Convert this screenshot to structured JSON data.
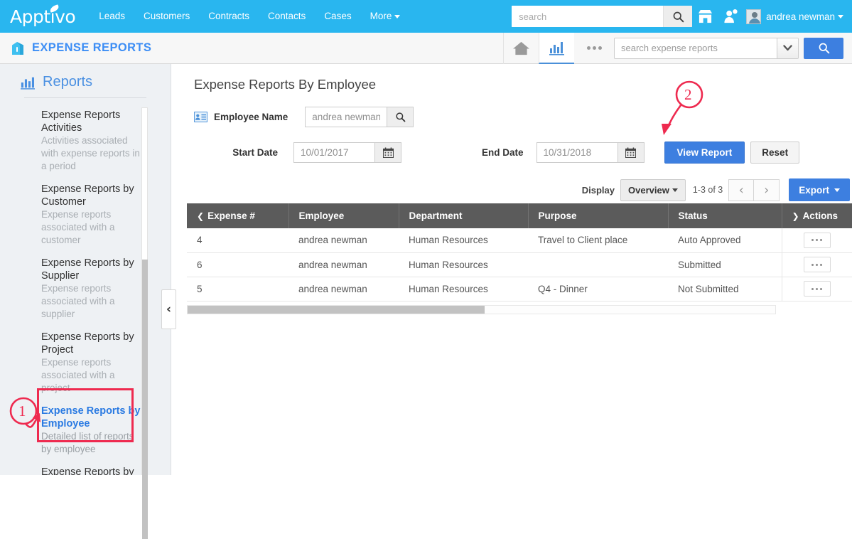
{
  "topnav": {
    "logo": "Apptivo",
    "links": [
      "Leads",
      "Customers",
      "Contracts",
      "Contacts",
      "Cases",
      "More"
    ],
    "search_placeholder": "search",
    "search_value": "",
    "icons": [
      "search-icon",
      "store-icon",
      "notifications-icon"
    ],
    "username": "andrea newman"
  },
  "appbar": {
    "title": "EXPENSE REPORTS",
    "icons": [
      "home-icon",
      "reports-chart-icon",
      "more-ellipsis-icon"
    ],
    "search_placeholder": "search expense reports",
    "search_value": ""
  },
  "sidebar": {
    "heading": "Reports",
    "items": [
      {
        "title": "Expense Reports Activities",
        "desc": "Activities associated with expense reports in a period",
        "active": false
      },
      {
        "title": "Expense Reports by Customer",
        "desc": "Expense reports associated with a customer",
        "active": false
      },
      {
        "title": "Expense Reports by Supplier",
        "desc": "Expense reports associated with a supplier",
        "active": false
      },
      {
        "title": "Expense Reports by Project",
        "desc": "Expense reports associated with a project",
        "active": false
      },
      {
        "title": "Expense Reports by Employee",
        "desc": "Detailed list of reports by employee",
        "active": true
      },
      {
        "title": "Expense Reports by Status",
        "desc": "",
        "active": false
      }
    ],
    "collapse_glyph": "‹"
  },
  "main": {
    "page_title": "Expense Reports By Employee",
    "filters": {
      "employee_label": "Employee Name",
      "employee_value": "andrea newman",
      "start_label": "Start Date",
      "start_value": "10/01/2017",
      "end_label": "End Date",
      "end_value": "10/31/2018",
      "view_report_label": "View Report",
      "reset_label": "Reset"
    },
    "toolbar": {
      "display_label": "Display",
      "display_value": "Overview",
      "page_count": "1-3 of 3",
      "prev_glyph": "‹",
      "next_glyph": "›",
      "export_label": "Export"
    },
    "table": {
      "columns": [
        "Expense #",
        "Employee",
        "Department",
        "Purpose",
        "Status",
        "Actions"
      ],
      "rows": [
        {
          "expense": "4",
          "employee": "andrea newman",
          "department": "Human Resources",
          "purpose": "Travel to Client place",
          "status": "Auto Approved"
        },
        {
          "expense": "6",
          "employee": "andrea newman",
          "department": "Human Resources",
          "purpose": "",
          "status": "Submitted"
        },
        {
          "expense": "5",
          "employee": "andrea newman",
          "department": "Human Resources",
          "purpose": "Q4 - Dinner",
          "status": "Not Submitted"
        }
      ]
    }
  },
  "annotations": [
    {
      "number": "1",
      "target": "sidebar-item-expense-reports-by-employee"
    },
    {
      "number": "2",
      "target": "view-report-button"
    }
  ],
  "colors": {
    "brand_blue": "#29b6ef",
    "action_blue": "#3d7fe0",
    "link_blue": "#2a7ae2",
    "table_header": "#5b5b5b",
    "annotation_red": "#ee2a4f",
    "sidebar_bg": "#eef1f4"
  }
}
